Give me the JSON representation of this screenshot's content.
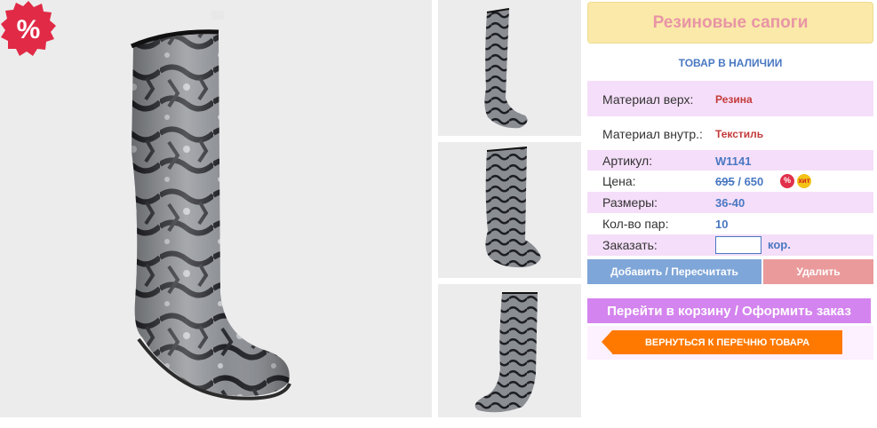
{
  "product": {
    "title": "Резиновые сапоги",
    "stock_status": "ТОВАР В НАЛИЧИИ",
    "sale_badge": "%"
  },
  "specs": {
    "material_top_label": "Материал верх:",
    "material_top_value": "Резина",
    "material_inner_label": "Материал внутр.:",
    "material_inner_value": "Текстиль",
    "sku_label": "Артикул:",
    "sku_value": "W1141",
    "price_label": "Цена:",
    "price_old": "695",
    "price_separator": "/",
    "price_new": "650",
    "sizes_label": "Размеры:",
    "sizes_value": "36-40",
    "pairs_label": "Кол-во пар:",
    "pairs_value": "10",
    "order_label": "Заказать:",
    "order_value": "",
    "order_unit": "кор."
  },
  "badges": {
    "percent": "%",
    "hit": "хит"
  },
  "buttons": {
    "add": "Добавить / Пересчитать",
    "delete": "Удалить",
    "cart": "Перейти в корзину / Оформить заказ",
    "back": "ВЕРНУТЬСЯ К ПЕРЕЧНЮ ТОВАРА"
  },
  "colors": {
    "title_bg": "#fae9a8",
    "title_text": "#e895a6",
    "accent_blue": "#4a78c2",
    "accent_red": "#c43a3a",
    "row_pink": "#f5def9",
    "cart_button": "#d484ee",
    "back_button": "#ff7900"
  }
}
